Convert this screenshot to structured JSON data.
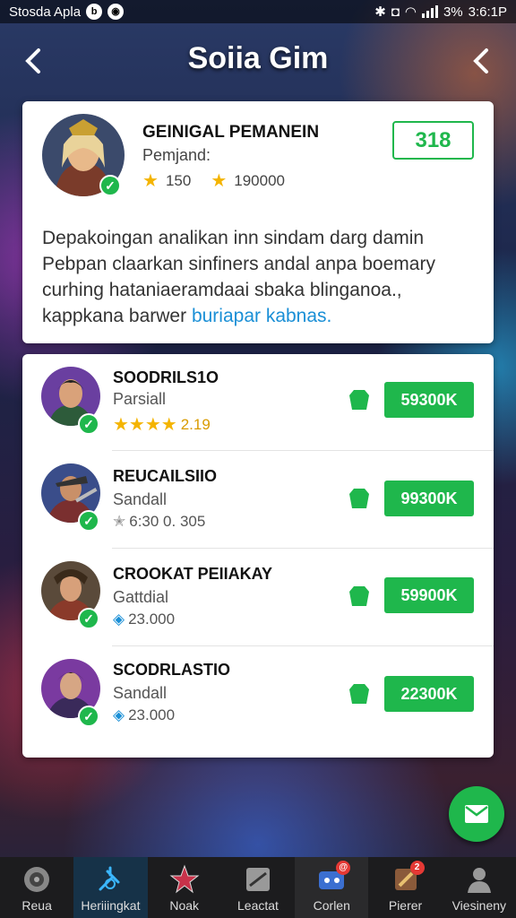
{
  "status_bar": {
    "app_name": "Stosda Apla",
    "battery": "3%",
    "time": "3:6:1P"
  },
  "header": {
    "title": "Soiia Gim"
  },
  "profile": {
    "name": "GΕΙNIGAL PEMANEIN",
    "subtitle": "Pemjand:",
    "stat_1": "150",
    "stat_2": "190000",
    "score": "318",
    "description_main": "Depakoingan analikan inn sindam darg damin Pebpan claarkan sinfiners andal anpa boemary curhing hataniaeramdaai sbaka blinganoa., kappkana barwer ",
    "description_link": "buriapar kabnas."
  },
  "players": [
    {
      "name": "SOODRILS1O",
      "role": "Parsiall",
      "meta_type": "stars",
      "meta": "2.19",
      "amount": "59300K"
    },
    {
      "name": "REUCAILSIIO",
      "role": "Sandall",
      "meta_type": "gray-star",
      "meta": "6:30  0. 305",
      "amount": "99300K"
    },
    {
      "name": "CROOKAT PEIIAKAY",
      "role": "Gattdial",
      "meta_type": "gem",
      "meta": "23.000",
      "amount": "59900K"
    },
    {
      "name": "SCODRLASTIO",
      "role": "Sandall",
      "meta_type": "gem",
      "meta": "23.000",
      "amount": "22300K"
    }
  ],
  "nav": [
    {
      "label": "Reua",
      "icon": "settings-wheel-icon"
    },
    {
      "label": "Heriiingkat",
      "icon": "sword-icon"
    },
    {
      "label": "Noak",
      "icon": "star-icon"
    },
    {
      "label": "Leactat",
      "icon": "stats-icon"
    },
    {
      "label": "Corlen",
      "icon": "gamepad-icon",
      "badge": "@"
    },
    {
      "label": "Pierer",
      "icon": "potion-icon",
      "badge": "2"
    },
    {
      "label": "Viesineny",
      "icon": "profile-icon"
    }
  ],
  "colors": {
    "accent": "#1fb74c",
    "link": "#1a8fd6"
  }
}
